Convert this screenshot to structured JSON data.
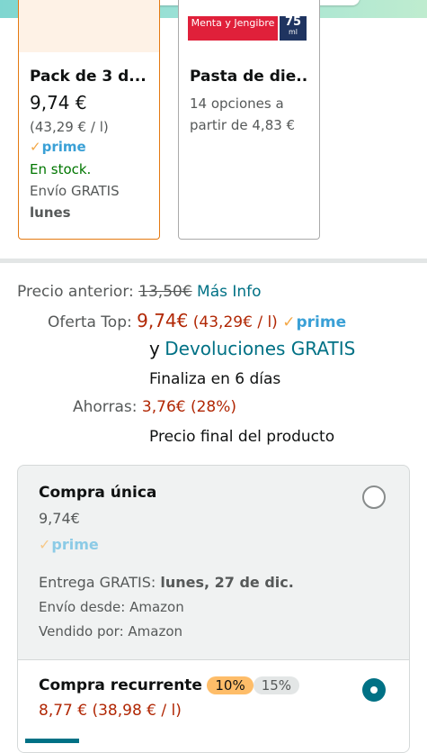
{
  "cards": [
    {
      "title": "Pack de 3 d...",
      "price": "9,74 €",
      "unit_price": "(43,29 € / l)",
      "prime": "prime",
      "stock": "En stock.",
      "shipping": "Envío GRATIS",
      "day": "lunes"
    },
    {
      "image_text_main": "Menta y Jengibre",
      "image_text_num": "75",
      "image_text_unit": "ml",
      "title": "Pasta de die...",
      "options_line1": "14 opciones a",
      "options_line2": "partir de 4,83 €"
    }
  ],
  "pricing": {
    "prev_label": "Precio anterior:",
    "prev_value": "13,50€",
    "more_info": "Más Info",
    "offer_label": "Oferta Top:",
    "offer_price": "9,74€",
    "offer_unit": "(43,29€ / l)",
    "prime": "prime",
    "and": "y",
    "returns": "Devoluciones GRATIS",
    "ends": "Finaliza en 6 días",
    "save_label": "Ahorras:",
    "save_value": "3,76€ (28%)",
    "final_note": "Precio final del producto"
  },
  "purchase_options": {
    "single": {
      "title": "Compra única",
      "price": "9,74€",
      "prime": "prime",
      "delivery_prefix": "Entrega GRATIS:",
      "delivery_date": "lunes, 27 de dic.",
      "ships_from": "Envío desde: Amazon",
      "sold_by": "Vendido por: Amazon",
      "selected": false
    },
    "recurring": {
      "title": "Compra recurrente",
      "discount_active": "10%",
      "discount_inactive": "15%",
      "price": "8,77 € (38,98 € / l)",
      "selected": true
    }
  },
  "colors": {
    "link": "#007185",
    "price_red": "#b12704",
    "stock_green": "#007600",
    "prime_blue": "#3aa0d6",
    "card_selected_border": "#e47911"
  }
}
